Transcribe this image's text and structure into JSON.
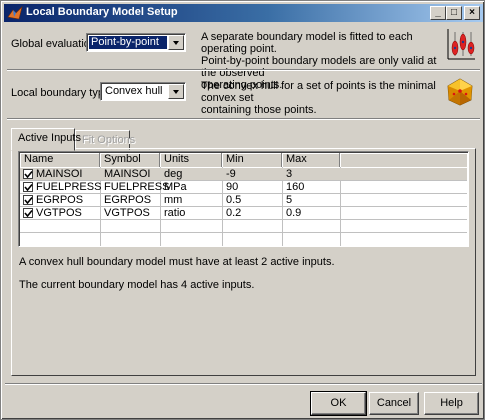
{
  "window": {
    "title": "Local Boundary Model Setup",
    "controls": {
      "minimize": "_",
      "maximize": "□",
      "close": "×"
    }
  },
  "global_evaluation": {
    "label": "Global evaluation:",
    "value": "Point-by-point",
    "description_line1": "A separate boundary model is fitted to each operating point.",
    "description_line2": "Point-by-point boundary models are only valid at the observed",
    "description_line3": "operating points.",
    "icon": "point-by-point-boundary-icon"
  },
  "local_boundary": {
    "label": "Local boundary type:",
    "value": "Convex hull",
    "description_line1": "The convex hull for a set of points is the minimal convex set",
    "description_line2": "containing those points.",
    "icon": "convex-hull-icon"
  },
  "tabs": [
    {
      "label": "Active Inputs",
      "active": true
    },
    {
      "label": "Fit Options",
      "active": false
    }
  ],
  "table": {
    "columns": [
      "Name",
      "Symbol",
      "Units",
      "Min",
      "Max"
    ],
    "rows": [
      {
        "checked": true,
        "name": "MAINSOI",
        "symbol": "MAINSOI",
        "units": "deg",
        "min": "-9",
        "max": "3"
      },
      {
        "checked": true,
        "name": "FUELPRESS",
        "symbol": "FUELPRESS",
        "units": "MPa",
        "min": "90",
        "max": "160"
      },
      {
        "checked": true,
        "name": "EGRPOS",
        "symbol": "EGRPOS",
        "units": "mm",
        "min": "0.5",
        "max": "5"
      },
      {
        "checked": true,
        "name": "VGTPOS",
        "symbol": "VGTPOS",
        "units": "ratio",
        "min": "0.2",
        "max": "0.9"
      }
    ]
  },
  "messages": {
    "min_inputs": "A convex hull boundary model must have at least 2 active inputs.",
    "current_inputs": "The current boundary model has 4 active inputs."
  },
  "buttons": {
    "ok": "OK",
    "cancel": "Cancel",
    "help": "Help"
  },
  "colors": {
    "titlebar_start": "#0a246a",
    "titlebar_end": "#a6caf0",
    "face": "#d4d0c8",
    "highlight": "#0a246a"
  }
}
